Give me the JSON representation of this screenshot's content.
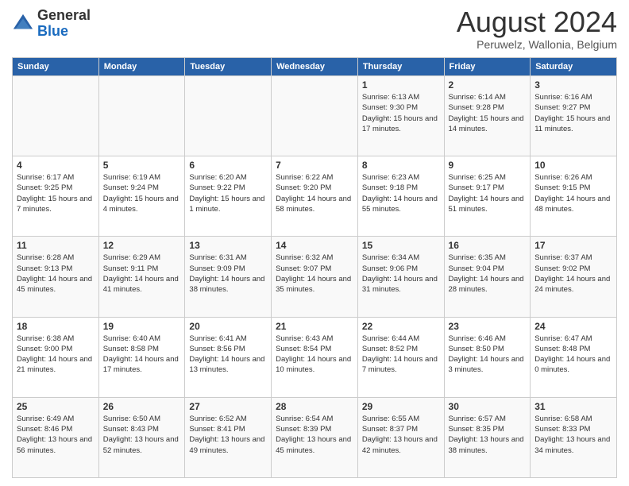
{
  "header": {
    "logo_general": "General",
    "logo_blue": "Blue",
    "month_title": "August 2024",
    "location": "Peruwelz, Wallonia, Belgium"
  },
  "days": [
    "Sunday",
    "Monday",
    "Tuesday",
    "Wednesday",
    "Thursday",
    "Friday",
    "Saturday"
  ],
  "weeks": [
    [
      {
        "date": "",
        "info": ""
      },
      {
        "date": "",
        "info": ""
      },
      {
        "date": "",
        "info": ""
      },
      {
        "date": "",
        "info": ""
      },
      {
        "date": "1",
        "info": "Sunrise: 6:13 AM\nSunset: 9:30 PM\nDaylight: 15 hours and 17 minutes."
      },
      {
        "date": "2",
        "info": "Sunrise: 6:14 AM\nSunset: 9:28 PM\nDaylight: 15 hours and 14 minutes."
      },
      {
        "date": "3",
        "info": "Sunrise: 6:16 AM\nSunset: 9:27 PM\nDaylight: 15 hours and 11 minutes."
      }
    ],
    [
      {
        "date": "4",
        "info": "Sunrise: 6:17 AM\nSunset: 9:25 PM\nDaylight: 15 hours and 7 minutes."
      },
      {
        "date": "5",
        "info": "Sunrise: 6:19 AM\nSunset: 9:24 PM\nDaylight: 15 hours and 4 minutes."
      },
      {
        "date": "6",
        "info": "Sunrise: 6:20 AM\nSunset: 9:22 PM\nDaylight: 15 hours and 1 minute."
      },
      {
        "date": "7",
        "info": "Sunrise: 6:22 AM\nSunset: 9:20 PM\nDaylight: 14 hours and 58 minutes."
      },
      {
        "date": "8",
        "info": "Sunrise: 6:23 AM\nSunset: 9:18 PM\nDaylight: 14 hours and 55 minutes."
      },
      {
        "date": "9",
        "info": "Sunrise: 6:25 AM\nSunset: 9:17 PM\nDaylight: 14 hours and 51 minutes."
      },
      {
        "date": "10",
        "info": "Sunrise: 6:26 AM\nSunset: 9:15 PM\nDaylight: 14 hours and 48 minutes."
      }
    ],
    [
      {
        "date": "11",
        "info": "Sunrise: 6:28 AM\nSunset: 9:13 PM\nDaylight: 14 hours and 45 minutes."
      },
      {
        "date": "12",
        "info": "Sunrise: 6:29 AM\nSunset: 9:11 PM\nDaylight: 14 hours and 41 minutes."
      },
      {
        "date": "13",
        "info": "Sunrise: 6:31 AM\nSunset: 9:09 PM\nDaylight: 14 hours and 38 minutes."
      },
      {
        "date": "14",
        "info": "Sunrise: 6:32 AM\nSunset: 9:07 PM\nDaylight: 14 hours and 35 minutes."
      },
      {
        "date": "15",
        "info": "Sunrise: 6:34 AM\nSunset: 9:06 PM\nDaylight: 14 hours and 31 minutes."
      },
      {
        "date": "16",
        "info": "Sunrise: 6:35 AM\nSunset: 9:04 PM\nDaylight: 14 hours and 28 minutes."
      },
      {
        "date": "17",
        "info": "Sunrise: 6:37 AM\nSunset: 9:02 PM\nDaylight: 14 hours and 24 minutes."
      }
    ],
    [
      {
        "date": "18",
        "info": "Sunrise: 6:38 AM\nSunset: 9:00 PM\nDaylight: 14 hours and 21 minutes."
      },
      {
        "date": "19",
        "info": "Sunrise: 6:40 AM\nSunset: 8:58 PM\nDaylight: 14 hours and 17 minutes."
      },
      {
        "date": "20",
        "info": "Sunrise: 6:41 AM\nSunset: 8:56 PM\nDaylight: 14 hours and 13 minutes."
      },
      {
        "date": "21",
        "info": "Sunrise: 6:43 AM\nSunset: 8:54 PM\nDaylight: 14 hours and 10 minutes."
      },
      {
        "date": "22",
        "info": "Sunrise: 6:44 AM\nSunset: 8:52 PM\nDaylight: 14 hours and 7 minutes."
      },
      {
        "date": "23",
        "info": "Sunrise: 6:46 AM\nSunset: 8:50 PM\nDaylight: 14 hours and 3 minutes."
      },
      {
        "date": "24",
        "info": "Sunrise: 6:47 AM\nSunset: 8:48 PM\nDaylight: 14 hours and 0 minutes."
      }
    ],
    [
      {
        "date": "25",
        "info": "Sunrise: 6:49 AM\nSunset: 8:46 PM\nDaylight: 13 hours and 56 minutes."
      },
      {
        "date": "26",
        "info": "Sunrise: 6:50 AM\nSunset: 8:43 PM\nDaylight: 13 hours and 52 minutes."
      },
      {
        "date": "27",
        "info": "Sunrise: 6:52 AM\nSunset: 8:41 PM\nDaylight: 13 hours and 49 minutes."
      },
      {
        "date": "28",
        "info": "Sunrise: 6:54 AM\nSunset: 8:39 PM\nDaylight: 13 hours and 45 minutes."
      },
      {
        "date": "29",
        "info": "Sunrise: 6:55 AM\nSunset: 8:37 PM\nDaylight: 13 hours and 42 minutes."
      },
      {
        "date": "30",
        "info": "Sunrise: 6:57 AM\nSunset: 8:35 PM\nDaylight: 13 hours and 38 minutes."
      },
      {
        "date": "31",
        "info": "Sunrise: 6:58 AM\nSunset: 8:33 PM\nDaylight: 13 hours and 34 minutes."
      }
    ]
  ]
}
